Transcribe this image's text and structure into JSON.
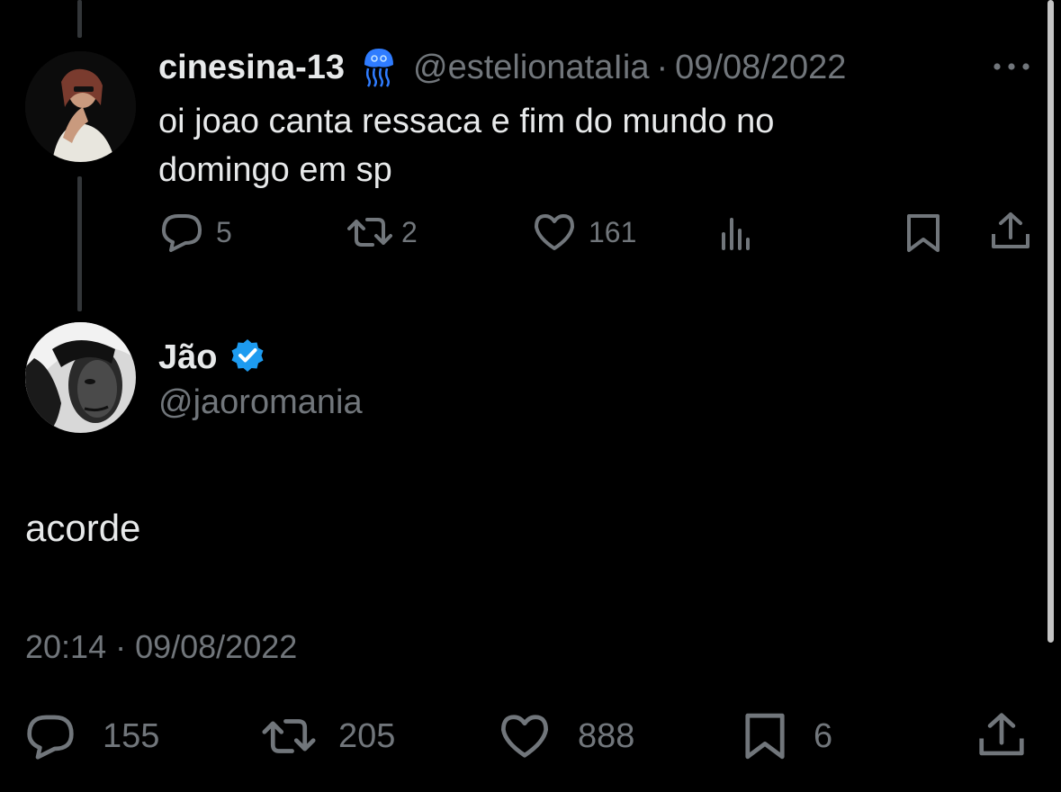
{
  "reply_parent": {
    "display_name": "cinesina-13",
    "emoji": "🪼",
    "handle": "@estelionataIia",
    "separator": "·",
    "date": "09/08/2022",
    "text_line1": "oi joao canta ressaca e fim do mundo no",
    "text_line2": "domingo em sp",
    "actions": {
      "replies": "5",
      "retweets": "2",
      "likes": "161"
    }
  },
  "main_tweet": {
    "display_name": "Jão",
    "verified": true,
    "handle": "@jaoromania",
    "text": "acorde",
    "timestamp": "20:14 · 09/08/2022",
    "actions": {
      "replies": "155",
      "retweets": "205",
      "likes": "888",
      "bookmarks": "6"
    }
  },
  "colors": {
    "background": "#000000",
    "text": "#e7e9ea",
    "muted": "#71767b",
    "verified": "#1d9bf0",
    "jellyfish": "#2f7cff",
    "thread_line": "#333639"
  },
  "icons": {
    "more": "more-icon",
    "reply": "reply-icon",
    "retweet": "retweet-icon",
    "like": "like-icon",
    "views": "views-icon",
    "bookmark": "bookmark-icon",
    "share": "share-icon",
    "verified": "verified-badge-icon"
  }
}
